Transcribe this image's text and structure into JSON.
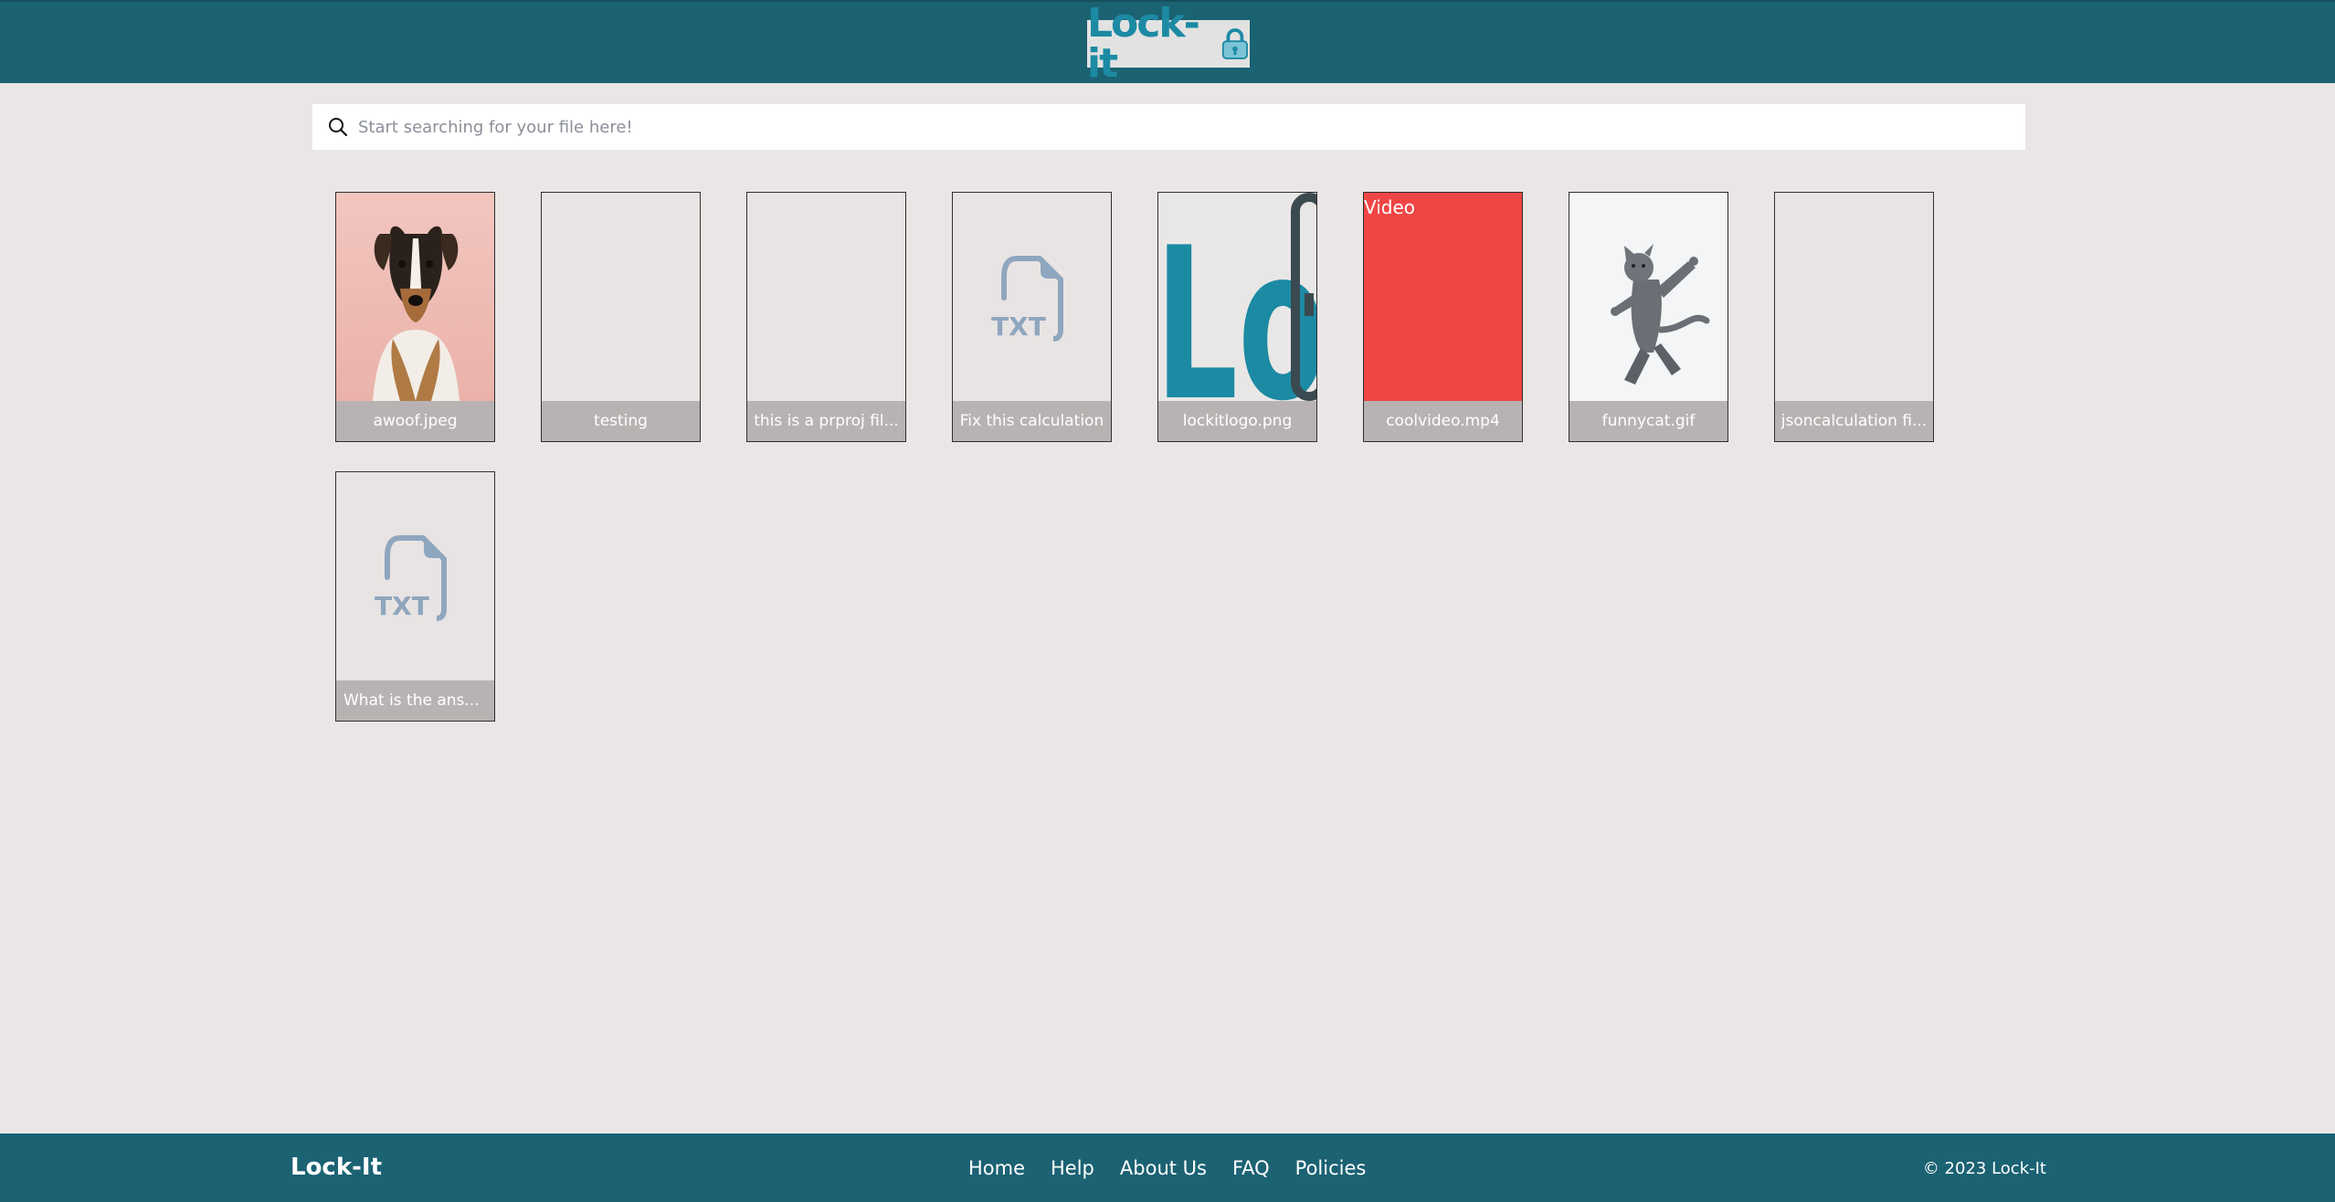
{
  "header": {
    "logo_text": "Lock-it"
  },
  "search": {
    "placeholder": "Start searching for your file here!"
  },
  "files": [
    {
      "name": "awoof.jpeg",
      "kind": "image-dog"
    },
    {
      "name": "testing",
      "kind": "blank"
    },
    {
      "name": "this is a prproj fil...",
      "kind": "blank"
    },
    {
      "name": "Fix this calculation",
      "kind": "txt"
    },
    {
      "name": "lockitlogo.png",
      "kind": "image-logo"
    },
    {
      "name": "coolvideo.mp4",
      "kind": "video",
      "thumb_label": "Video"
    },
    {
      "name": "funnycat.gif",
      "kind": "image-cat"
    },
    {
      "name": "jsoncalculation fi...",
      "kind": "blank"
    },
    {
      "name": "What is the ans...",
      "kind": "txt"
    }
  ],
  "txt_icon_label": "TXT",
  "logo_thumb_text": "LockIt",
  "footer": {
    "brand": "Lock-It",
    "nav": [
      "Home",
      "Help",
      "About Us",
      "FAQ",
      "Policies"
    ],
    "copyright": "© 2023 Lock-It"
  },
  "colors": {
    "header_bg": "#1b6273",
    "page_bg": "#eae6e5",
    "caption_bg": "#b8b3b2",
    "brand_teal": "#1c8aa3",
    "video_red": "#f04545",
    "txt_icon": "#8fa6bf"
  }
}
